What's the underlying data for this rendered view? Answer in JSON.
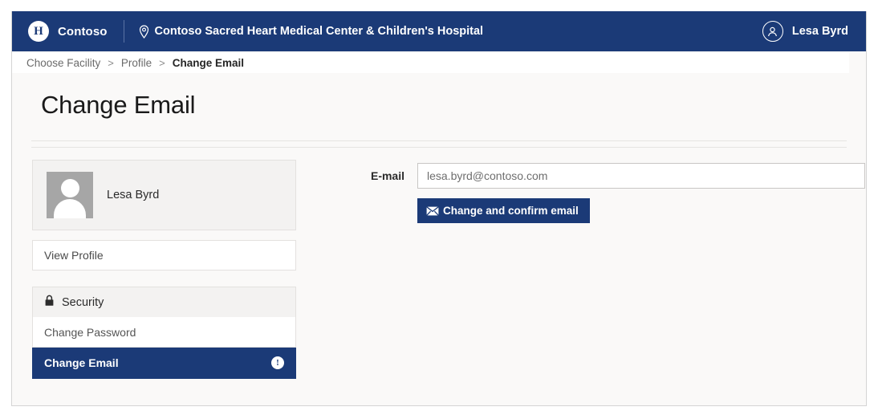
{
  "header": {
    "logo_letter": "H",
    "brand": "Contoso",
    "pin_icon": "map-pin-icon",
    "facility": "Contoso Sacred Heart Medical Center & Children's Hospital",
    "user_name": "Lesa Byrd",
    "user_icon": "person-icon",
    "background": "#1b3a77"
  },
  "breadcrumb": {
    "items": [
      {
        "label": "Choose Facility",
        "current": false
      },
      {
        "label": "Profile",
        "current": false
      },
      {
        "label": "Change Email",
        "current": true
      }
    ],
    "separator": ">"
  },
  "page": {
    "title": "Change Email"
  },
  "sidebar": {
    "profile": {
      "name": "Lesa Byrd",
      "avatar_icon": "avatar-placeholder-icon"
    },
    "view_profile": {
      "label": "View Profile"
    },
    "security_group": {
      "label": "Security",
      "icon": "lock-icon",
      "items": [
        {
          "label": "Change Password",
          "active": false,
          "badge_icon": ""
        },
        {
          "label": "Change Email",
          "active": true,
          "badge_icon": "info-icon"
        }
      ]
    }
  },
  "form": {
    "email_label": "E-mail",
    "email_value": "lesa.byrd@contoso.com",
    "email_placeholder": "lesa.byrd@contoso.com",
    "submit_label": "Change and confirm email",
    "submit_icon": "envelope-icon",
    "accent_color": "#1b3a77"
  }
}
